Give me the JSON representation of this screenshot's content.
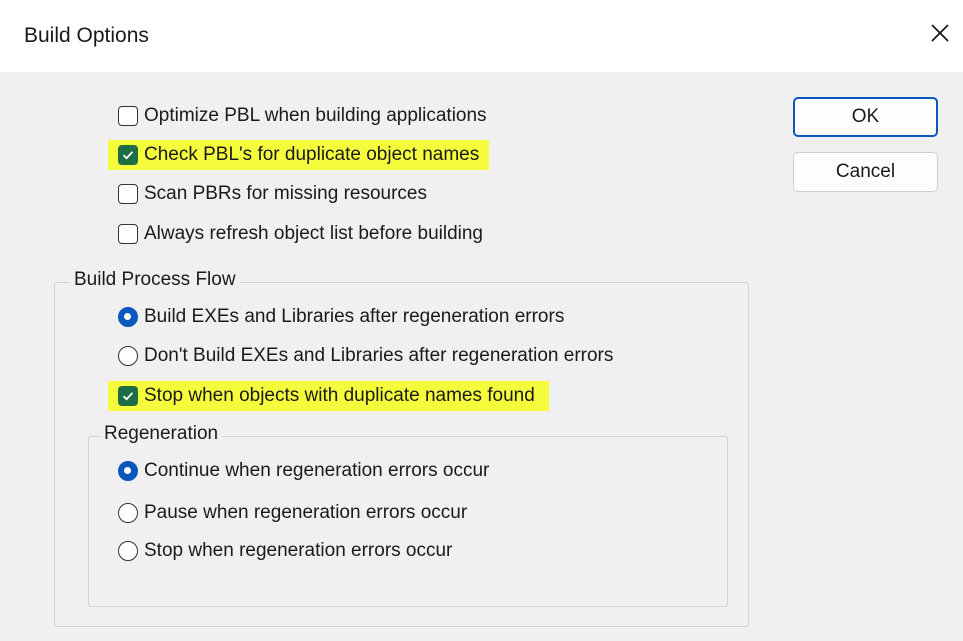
{
  "window": {
    "title": "Build Options",
    "close_icon": "close-icon"
  },
  "options": [
    {
      "label": "Optimize PBL when building applications",
      "checked": false,
      "highlighted": false
    },
    {
      "label": "Check PBL's for duplicate object names",
      "checked": true,
      "highlighted": true
    },
    {
      "label": "Scan PBRs for missing resources",
      "checked": false,
      "highlighted": false
    },
    {
      "label": "Always refresh object list before building",
      "checked": false,
      "highlighted": false
    }
  ],
  "build_process_flow": {
    "legend": "Build Process Flow",
    "radios": [
      {
        "label": "Build EXEs and Libraries after regeneration errors",
        "selected": true
      },
      {
        "label": "Don't Build EXEs and Libraries after regeneration errors",
        "selected": false
      }
    ],
    "stop_duplicates": {
      "label": "Stop when objects with duplicate names found",
      "checked": true,
      "highlighted": true
    }
  },
  "regeneration": {
    "legend": "Regeneration",
    "radios": [
      {
        "label": "Continue when regeneration errors occur",
        "selected": true
      },
      {
        "label": "Pause when regeneration errors occur",
        "selected": false
      },
      {
        "label": "Stop when regeneration errors occur",
        "selected": false
      }
    ]
  },
  "buttons": {
    "ok": "OK",
    "cancel": "Cancel"
  },
  "colors": {
    "highlight": "#f5fc3c",
    "checkbox_checked": "#1f6d44",
    "radio_selected": "#0b58bd",
    "dialog_bg": "#f0f0f0"
  }
}
